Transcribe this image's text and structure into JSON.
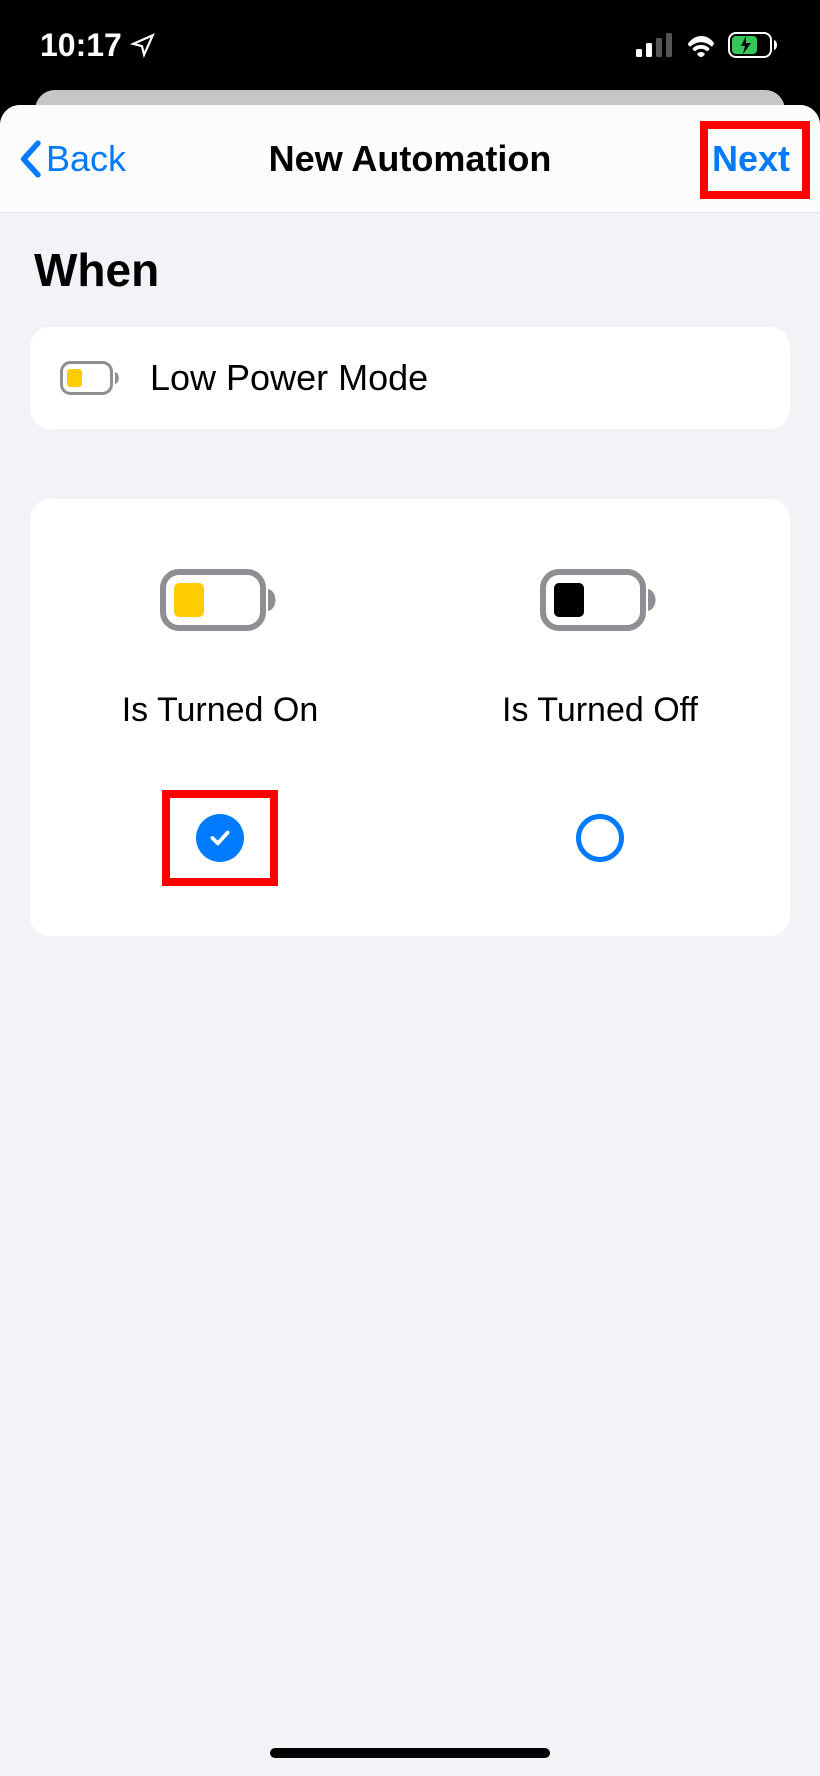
{
  "status_bar": {
    "time": "10:17"
  },
  "nav": {
    "back_label": "Back",
    "title": "New Automation",
    "next_label": "Next"
  },
  "section": {
    "title": "When",
    "trigger_label": "Low Power Mode"
  },
  "options": [
    {
      "label": "Is Turned On",
      "selected": true
    },
    {
      "label": "Is Turned Off",
      "selected": false
    }
  ]
}
